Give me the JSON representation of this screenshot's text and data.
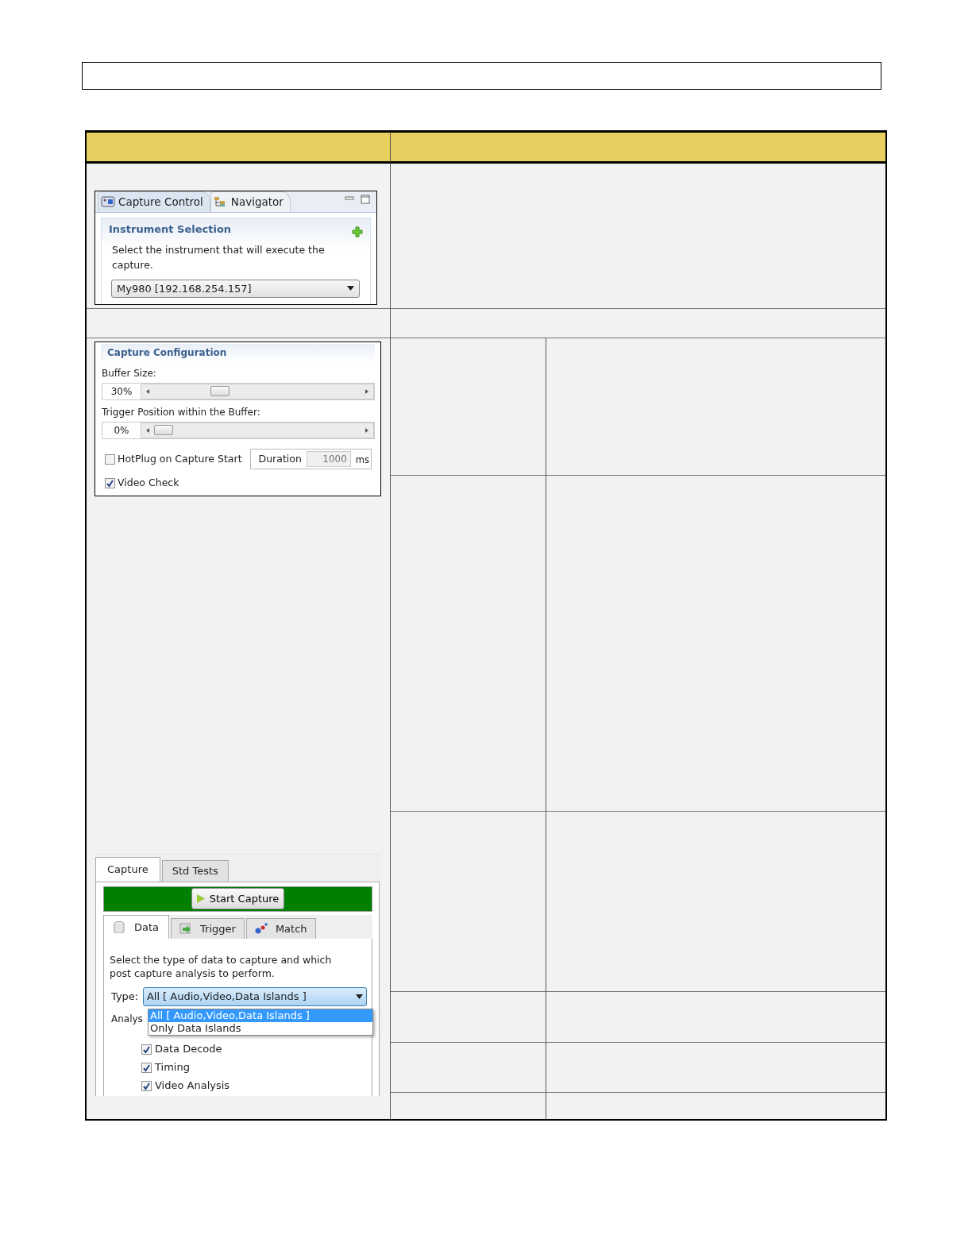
{
  "panel_tabs": [
    {
      "label": "Capture Control",
      "selected": true
    },
    {
      "label": "Navigator",
      "selected": false
    }
  ],
  "instrument_selection": {
    "title": "Instrument Selection",
    "description": "Select the instrument that will execute the capture.",
    "device": "My980 [192.168.254.157]"
  },
  "capture_configuration": {
    "title": "Capture Configuration",
    "sliders": [
      {
        "label": "Buffer Size:",
        "reading": "30%",
        "level": 0.3
      },
      {
        "label": "Trigger Position within the Buffer:",
        "reading": "0%",
        "level": 0
      }
    ],
    "hotplug": {
      "label": "HotPlug on Capture Start",
      "checked": false
    },
    "duration": {
      "label": "Duration",
      "value": "1000",
      "unit": "ms"
    },
    "video_check": {
      "label": "Video Check",
      "checked": true
    }
  },
  "main_tabs": [
    {
      "label": "Capture",
      "selected": true
    },
    {
      "label": "Std Tests",
      "selected": false
    }
  ],
  "start_button": "Start Capture",
  "data_tabs": [
    {
      "label": "Data",
      "selected": true
    },
    {
      "label": "Trigger",
      "selected": false
    },
    {
      "label": "Match",
      "selected": false
    }
  ],
  "data_description": "Select the type of data to capture and which post capture analysis to perform.",
  "type": {
    "label": "Type:",
    "value": "All [ Audio,Video,Data Islands ]",
    "options": [
      {
        "label": "All [ Audio,Video,Data Islands ]",
        "selected": true
      },
      {
        "label": "Only Data Islands",
        "selected": false
      }
    ]
  },
  "analysis_label": "Analys",
  "analysis": [
    {
      "label": "Data Decode",
      "checked": true
    },
    {
      "label": "Timing",
      "checked": true
    },
    {
      "label": "Video Analysis",
      "checked": true
    }
  ]
}
